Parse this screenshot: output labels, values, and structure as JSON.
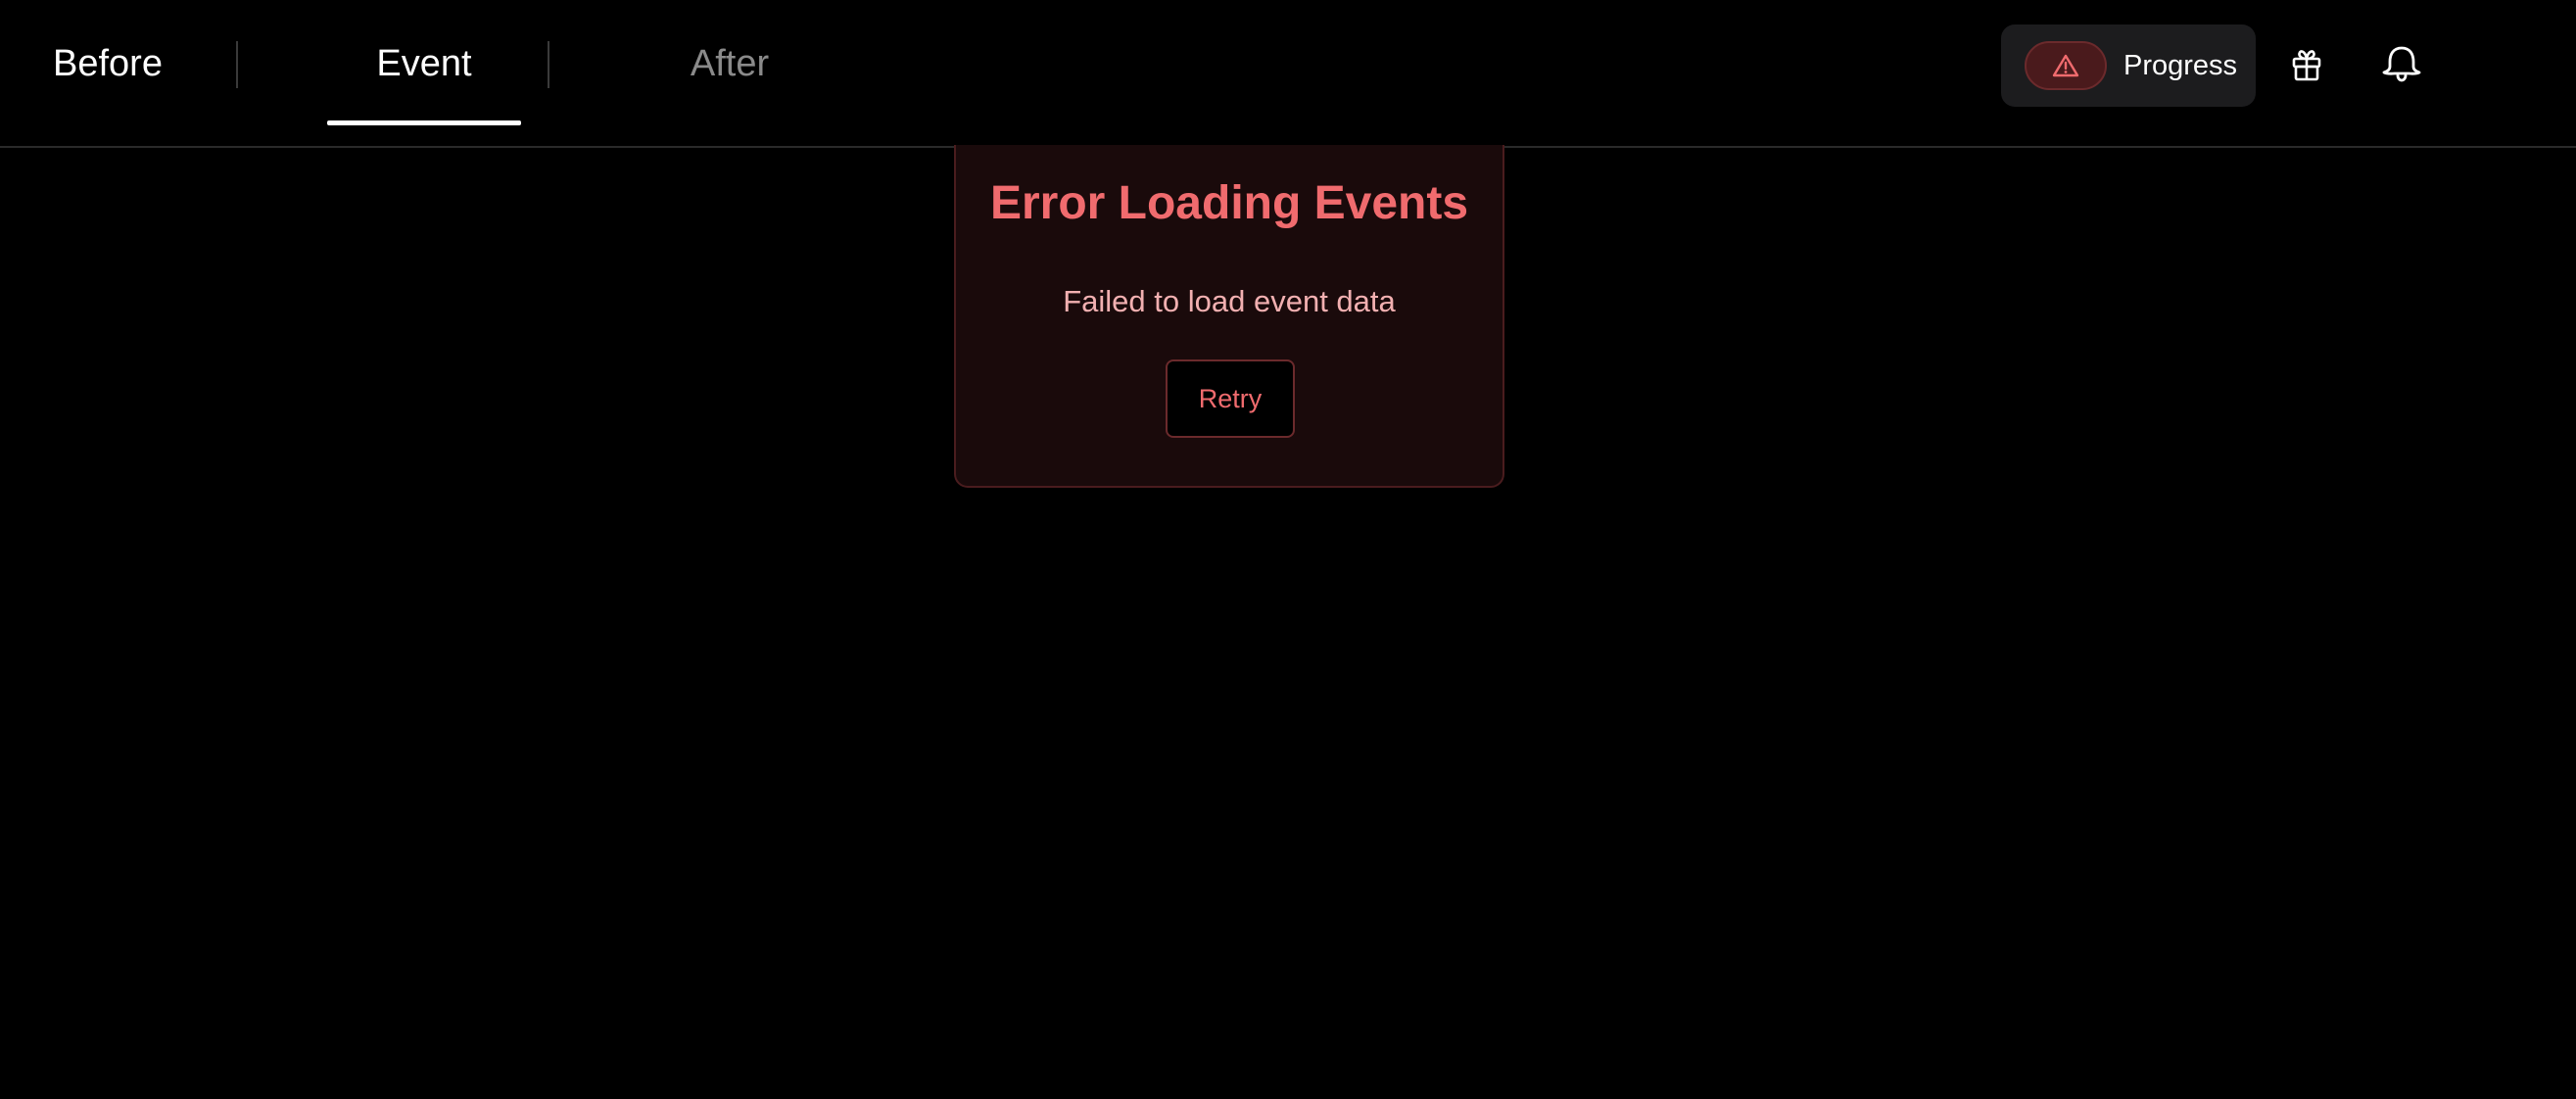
{
  "tabs": {
    "before_label": "Before",
    "event_label": "Event",
    "after_label": "After",
    "active": "Event"
  },
  "header": {
    "progress_label": "Progress",
    "progress_icon": "warning-triangle-icon",
    "gift_icon": "gift-icon",
    "notification_icon": "bell-icon"
  },
  "error": {
    "title": "Error Loading Events",
    "message": "Failed to load event data",
    "retry_label": "Retry"
  },
  "colors": {
    "background": "#000000",
    "error_accent": "#f06b6e",
    "error_text": "#f2b0b1",
    "card_background": "#1a0a0b",
    "inactive_tab": "#8a8a8a"
  }
}
